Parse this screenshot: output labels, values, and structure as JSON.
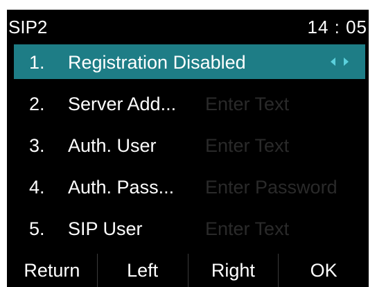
{
  "status": {
    "title": "SIP2",
    "time": "14 : 05"
  },
  "menu": {
    "items": [
      {
        "num": "1.",
        "label": "Registration Disabled",
        "value": ""
      },
      {
        "num": "2.",
        "label": "Server Add...",
        "value": "Enter Text"
      },
      {
        "num": "3.",
        "label": "Auth. User",
        "value": "Enter Text"
      },
      {
        "num": "4.",
        "label": "Auth. Pass...",
        "value": "Enter Password"
      },
      {
        "num": "5.",
        "label": "SIP User",
        "value": "Enter Text"
      }
    ]
  },
  "softkeys": {
    "return": "Return",
    "left": "Left",
    "right": "Right",
    "ok": "OK"
  },
  "colors": {
    "highlight": "#1e7d86",
    "arrow": "#5bd0dc"
  },
  "icons": {
    "selector": "left-right-arrows-icon"
  }
}
